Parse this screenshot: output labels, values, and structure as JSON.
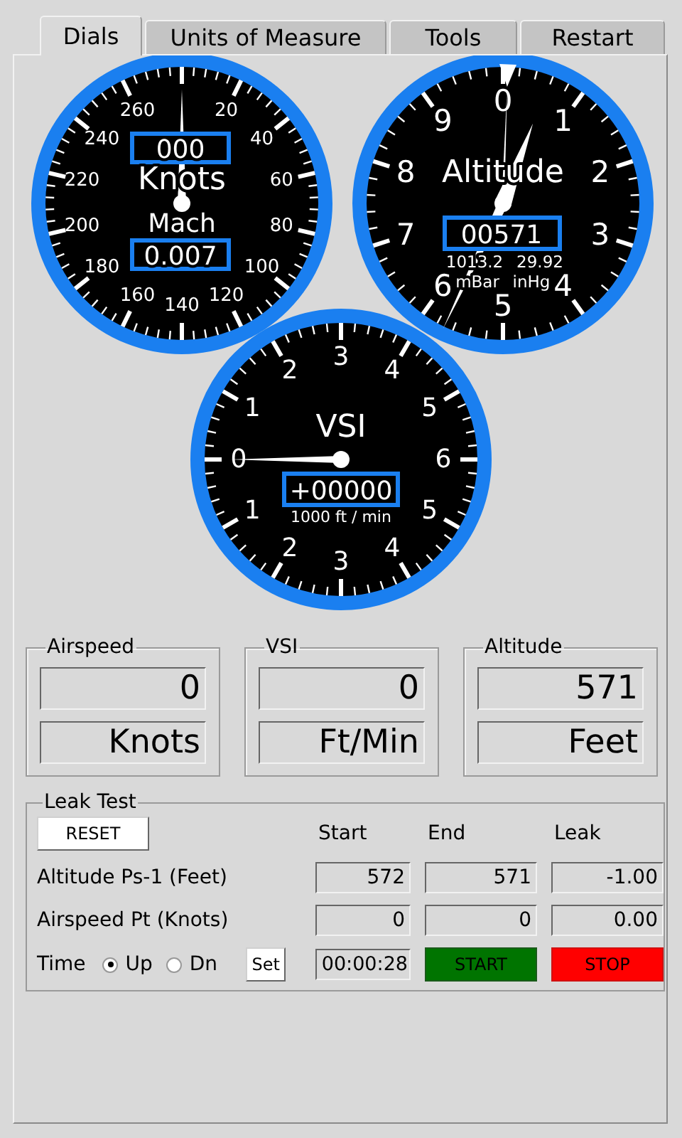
{
  "tabs": [
    {
      "label": "Dials",
      "selected": true
    },
    {
      "label": "Units of Measure",
      "selected": false
    },
    {
      "label": "Tools",
      "selected": false
    },
    {
      "label": "Restart",
      "selected": false
    }
  ],
  "gauges": [
    {
      "kind": "airspeed",
      "scale_labels": [
        "20",
        "40",
        "60",
        "80",
        "100",
        "120",
        "140",
        "160",
        "180",
        "200",
        "220",
        "240",
        "260"
      ],
      "readout": "000",
      "title": "Knots",
      "sub_title": "Mach",
      "sub_readout": "0.007"
    },
    {
      "kind": "altitude",
      "scale_labels": [
        "0",
        "1",
        "2",
        "3",
        "4",
        "5",
        "6",
        "7",
        "8",
        "9"
      ],
      "title": "Altitude",
      "readout": "00571",
      "pressure_values": [
        "1013.2",
        "29.92"
      ],
      "pressure_units": [
        "mBar",
        "inHg"
      ]
    },
    {
      "kind": "vsi",
      "upper_labels": [
        "0",
        "1",
        "2",
        "3",
        "4",
        "5",
        "6"
      ],
      "lower_labels": [
        "1",
        "2",
        "3",
        "4",
        "5"
      ],
      "title": "VSI",
      "readout": "+00000",
      "units": "1000 ft / min"
    }
  ],
  "readouts": [
    {
      "title": "Airspeed",
      "value": "0",
      "unit": "Knots"
    },
    {
      "title": "VSI",
      "value": "0",
      "unit": "Ft/Min"
    },
    {
      "title": "Altitude",
      "value": "571",
      "unit": "Feet"
    }
  ],
  "leak_test": {
    "title": "Leak Test",
    "reset_button": "RESET",
    "columns": [
      "Start",
      "End",
      "Leak"
    ],
    "rows": [
      {
        "label": "Altitude Ps-1 (Feet)",
        "values": [
          "572",
          "571",
          "-1.00"
        ]
      },
      {
        "label": "Airspeed Pt (Knots)",
        "values": [
          "0",
          "0",
          "0.00"
        ]
      }
    ],
    "time_label": "Time",
    "direction_options": [
      {
        "label": "Up",
        "selected": true
      },
      {
        "label": "Dn",
        "selected": false
      }
    ],
    "set_button": "Set",
    "elapsed": "00:00:28",
    "start_button": "START",
    "stop_button": "STOP"
  }
}
